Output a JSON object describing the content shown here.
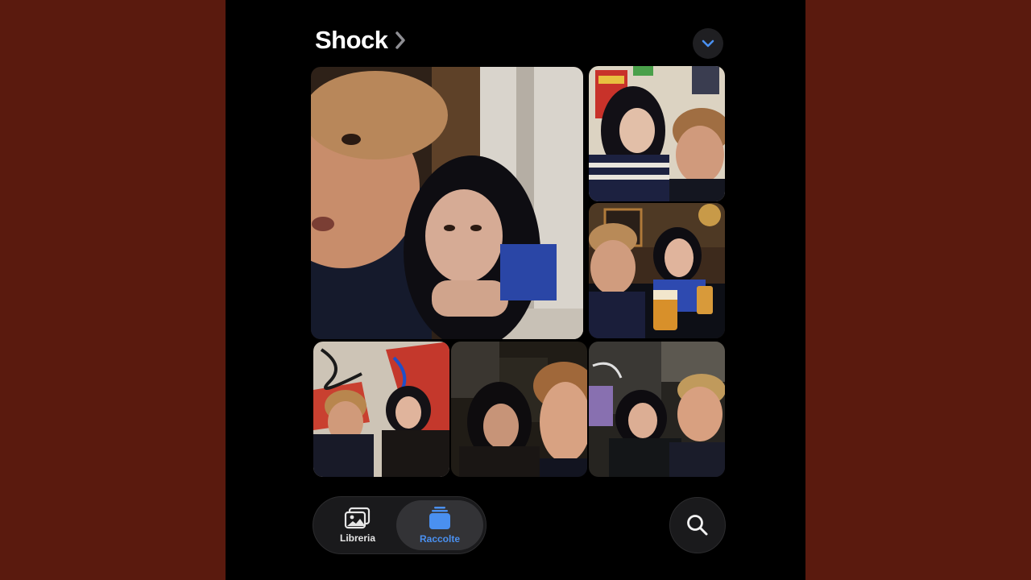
{
  "header": {
    "title": "Shock"
  },
  "photos": [
    {
      "description": "Selfie of young man with curly hair and woman with dark hair leaning on hand by window",
      "palette": [
        "#2a1c16",
        "#d7c7b5",
        "#10131f"
      ]
    },
    {
      "description": "Woman and man at table in front of posters",
      "palette": [
        "#d8cdb8",
        "#1a1822"
      ]
    },
    {
      "description": "Man and woman at bar table with two beers",
      "palette": [
        "#4a2f1a",
        "#10131c",
        "#c9902b"
      ]
    },
    {
      "description": "Man and woman in front of graffiti wall",
      "palette": [
        "#c9c0b4",
        "#c4382c",
        "#1a1612"
      ]
    },
    {
      "description": "Woman and man in car at night",
      "palette": [
        "#1e1a14",
        "#3c342a",
        "#a66a3c"
      ]
    },
    {
      "description": "Woman and man selfie on street at night",
      "palette": [
        "#26241f",
        "#4d4942",
        "#12141a"
      ]
    }
  ],
  "tabs": {
    "library": "Libreria",
    "collections": "Raccolte"
  },
  "colors": {
    "accent": "#4a90f0",
    "background": "#5a1a0e"
  }
}
